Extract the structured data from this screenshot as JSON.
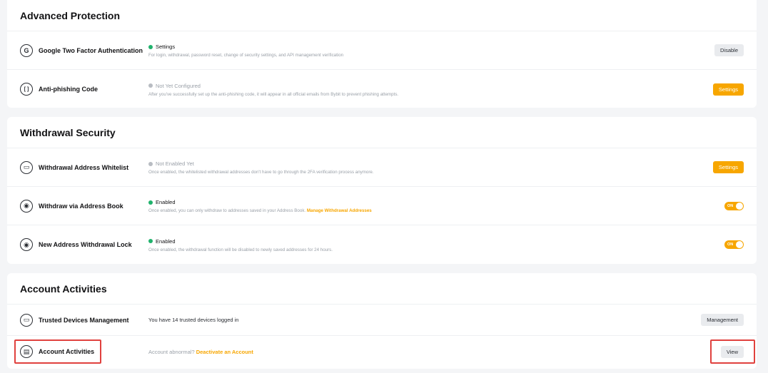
{
  "advanced_protection": {
    "title": "Advanced Protection",
    "google_2fa": {
      "label": "Google Two Factor Authentication",
      "status": "Settings",
      "description": "For login, withdrawal, password reset, change of security settings, and API management verification",
      "button": "Disable",
      "icon": "google-authenticator-icon"
    },
    "anti_phishing": {
      "label": "Anti-phishing Code",
      "status": "Not Yet Configured",
      "description": "After you've successfully set up the anti-phishing code, it will appear in all official emails from Bybit to prevent phishing attempts.",
      "button": "Settings",
      "icon": "anti-phishing-icon"
    }
  },
  "withdrawal_security": {
    "title": "Withdrawal Security",
    "address_whitelist": {
      "label": "Withdrawal Address Whitelist",
      "status": "Not Enabled Yet",
      "description": "Once enabled, the whitelisted withdrawal addresses don't have to go through the 2FA verification process anymore.",
      "button": "Settings",
      "icon": "wallet-icon"
    },
    "address_book": {
      "label": "Withdraw via Address Book",
      "status": "Enabled",
      "description": "Once enabled, you can only withdraw to addresses saved in your Address Book.",
      "link": "Manage Withdrawal Addresses",
      "toggle_label": "ON",
      "icon": "location-pin-icon"
    },
    "withdrawal_lock": {
      "label": "New Address Withdrawal Lock",
      "status": "Enabled",
      "description": "Once enabled, the withdrawal function will be disabled to newly saved addresses for 24 hours.",
      "toggle_label": "ON",
      "icon": "location-pin-icon"
    }
  },
  "account_activities": {
    "title": "Account Activities",
    "trusted_devices": {
      "label": "Trusted Devices Management",
      "text": "You have 14 trusted devices logged in",
      "button": "Management",
      "icon": "monitor-icon"
    },
    "activities": {
      "label": "Account Activities",
      "text": "Account abnormal?",
      "link": "Deactivate an Account",
      "button": "View",
      "icon": "document-icon"
    }
  },
  "colors": {
    "accent": "#f7a600",
    "enabled": "#20b26c",
    "highlight": "#e0413e"
  }
}
